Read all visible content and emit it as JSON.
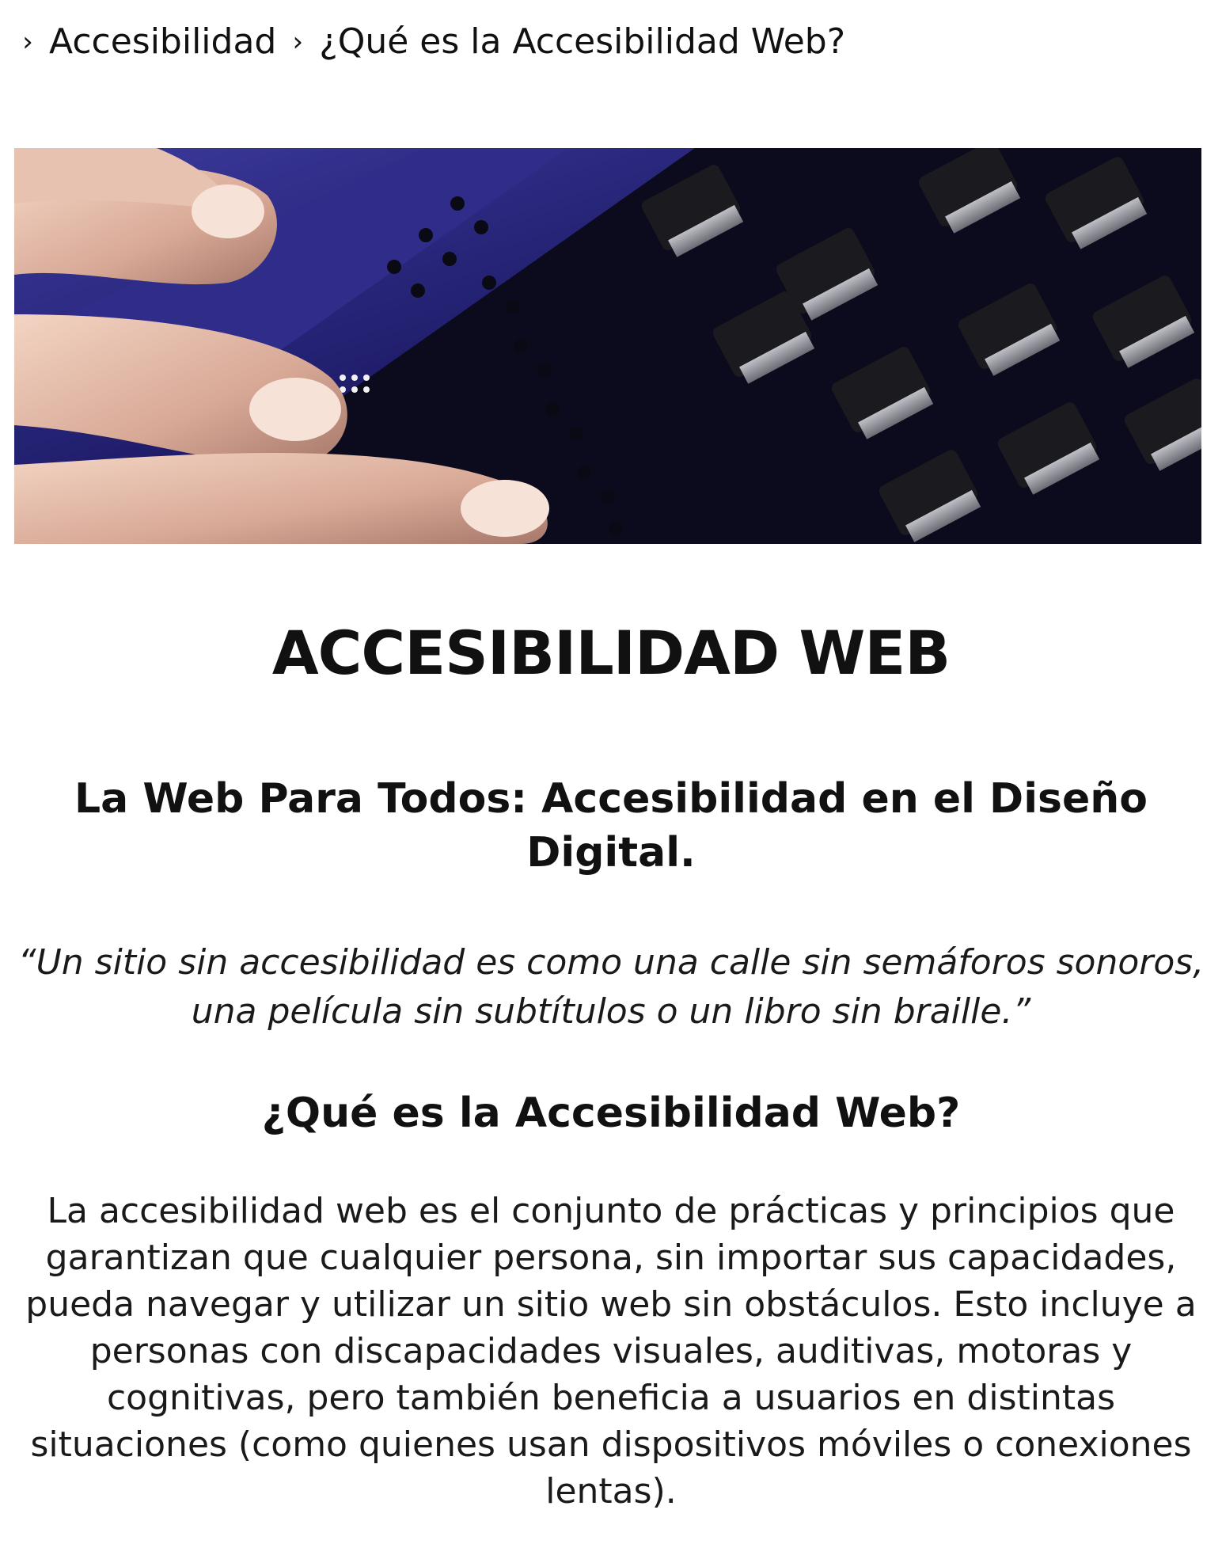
{
  "breadcrumb": {
    "items": [
      {
        "label": "Accesibilidad"
      },
      {
        "label": "¿Qué es la Accesibilidad Web?"
      }
    ]
  },
  "hero": {
    "icon": "braille-display-and-keyboard-photo"
  },
  "page_title": "ACCESIBILIDAD WEB",
  "subtitle": "La Web Para Todos: Accesibilidad en el Diseño Digital.",
  "quote": "“Un sitio sin accesibilidad es como una calle sin semáforos sonoros, una película sin subtítulos o un libro sin braille.”",
  "section": {
    "heading": "¿Qué es la Accesibilidad Web?",
    "body": "La accesibilidad web es el conjunto de prácticas y principios que garantizan que cualquier persona, sin importar sus capacidades, pueda navegar y utilizar un sitio web sin obstáculos. Esto incluye a personas con discapacidades visuales, auditivas, motoras y cognitivas, pero también beneficia a usuarios en distintas situaciones (como quienes usan dispositivos móviles o conexiones lentas)."
  },
  "colors": {
    "text": "#111111",
    "background": "#ffffff",
    "hero_blue": "#2a2a7a"
  }
}
